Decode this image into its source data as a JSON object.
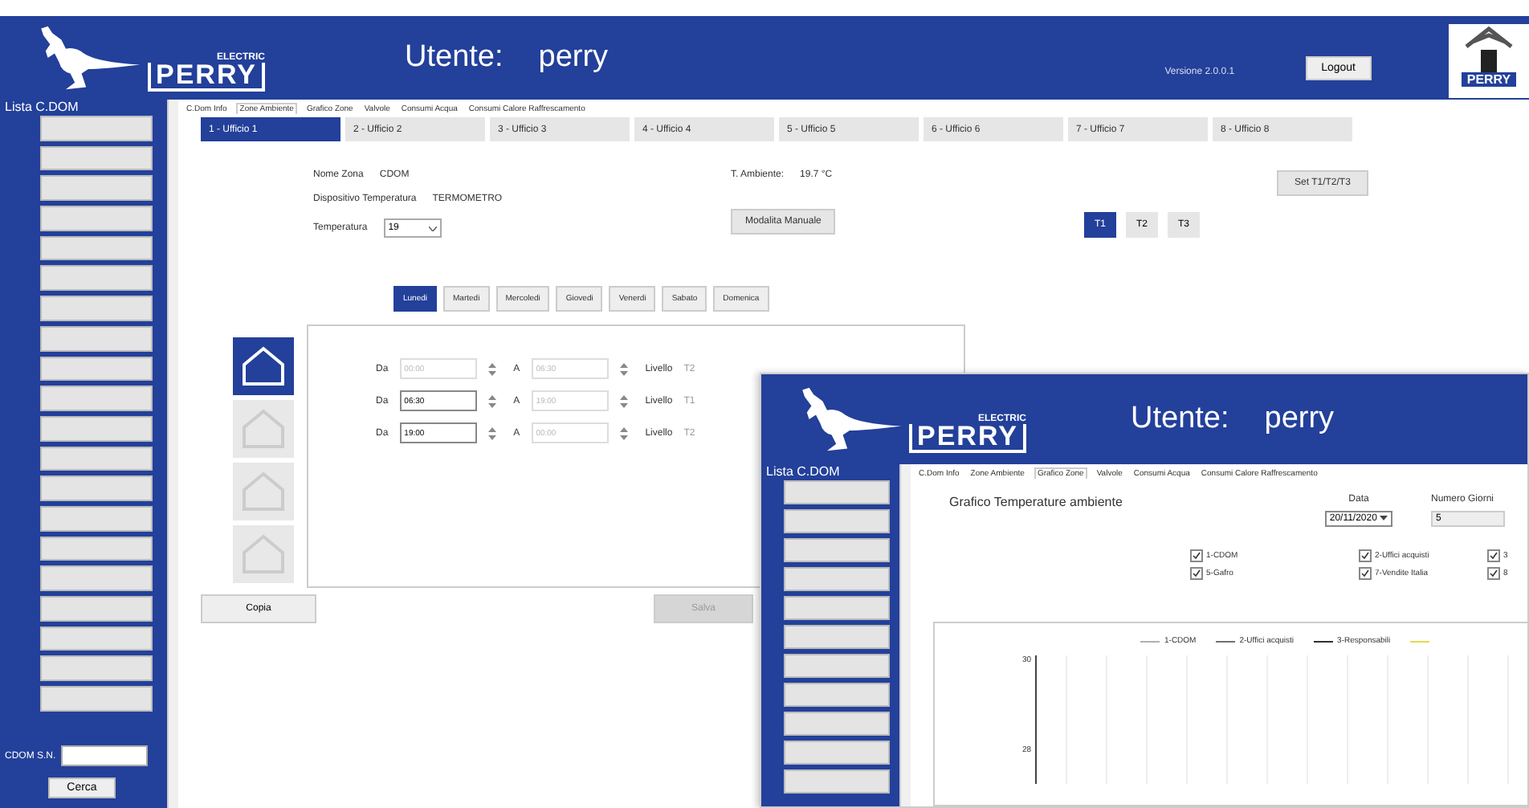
{
  "header": {
    "logo_small": "ELECTRIC",
    "logo_brand": "PERRY",
    "user_label": "Utente:",
    "user_name": "perry",
    "version": "Versione 2.0.0.1",
    "logout_button": "Logout",
    "home_logo_text": "PERRY"
  },
  "sidebar": {
    "title": "Lista C.DOM",
    "search_label": "CDOM S.N.",
    "search_button": "Cerca"
  },
  "sub_tabs": [
    {
      "label": "C.Dom Info",
      "selected": false
    },
    {
      "label": "Zone Ambiente",
      "selected": true
    },
    {
      "label": "Grafico Zone",
      "selected": false
    },
    {
      "label": "Valvole",
      "selected": false
    },
    {
      "label": "Consumi Acqua",
      "selected": false
    },
    {
      "label": "Consumi Calore Raffrescamento",
      "selected": false
    }
  ],
  "zone_tabs": [
    {
      "label": "1 - Ufficio 1",
      "selected": true
    },
    {
      "label": "2 - Ufficio 2",
      "selected": false
    },
    {
      "label": "3 - Ufficio 3",
      "selected": false
    },
    {
      "label": "4 - Ufficio 4",
      "selected": false
    },
    {
      "label": "5 - Ufficio 5",
      "selected": false
    },
    {
      "label": "6 - Ufficio 6",
      "selected": false
    },
    {
      "label": "7 - Ufficio 7",
      "selected": false
    },
    {
      "label": "8 - Ufficio 8",
      "selected": false
    }
  ],
  "zone": {
    "name_label": "Nome Zona",
    "name": "CDOM",
    "device_label": "Dispositivo Temperatura",
    "device": "TERMOMETRO",
    "temp_label": "Temperatura",
    "temp_value": "19",
    "ambient_label": "T. Ambiente:",
    "ambient_value": "19.7 °C",
    "mode_button": "Modalita Manuale",
    "set_button": "Set T1/T2/T3",
    "levels": [
      {
        "label": "T1",
        "selected": true
      },
      {
        "label": "T2",
        "selected": false
      },
      {
        "label": "T3",
        "selected": false
      }
    ]
  },
  "day_tabs": [
    {
      "label": "Lunedi",
      "selected": true
    },
    {
      "label": "Martedi",
      "selected": false
    },
    {
      "label": "Mercoledi",
      "selected": false
    },
    {
      "label": "Giovedi",
      "selected": false
    },
    {
      "label": "Venerdi",
      "selected": false
    },
    {
      "label": "Sabato",
      "selected": false
    },
    {
      "label": "Domenica",
      "selected": false
    }
  ],
  "mode_icons": [
    {
      "selected": true
    },
    {
      "selected": false
    },
    {
      "selected": false
    },
    {
      "selected": false
    }
  ],
  "schedule": [
    {
      "from_label": "Da",
      "from": "00:00",
      "from_disabled": true,
      "to_label": "A",
      "to": "06:30",
      "to_disabled": true,
      "level_label": "Livello",
      "level": "T2"
    },
    {
      "from_label": "Da",
      "from": "06:30",
      "from_disabled": false,
      "to_label": "A",
      "to": "19:00",
      "to_disabled": true,
      "level_label": "Livello",
      "level": "T1"
    },
    {
      "from_label": "Da",
      "from": "19:00",
      "from_disabled": false,
      "to_label": "A",
      "to": "00:00",
      "to_disabled": true,
      "level_label": "Livello",
      "level": "T2"
    }
  ],
  "copy_button": "Copia",
  "save_button": {
    "label": "Salva",
    "disabled": true
  },
  "overlay": {
    "user_label": "Utente:",
    "user_name": "perry",
    "logo_small": "ELECTRIC",
    "logo_brand": "PERRY",
    "sidebar_title": "Lista C.DOM",
    "sub_tabs": [
      {
        "label": "C.Dom Info",
        "selected": false
      },
      {
        "label": "Zone Ambiente",
        "selected": false
      },
      {
        "label": "Grafico Zone",
        "selected": true
      },
      {
        "label": "Valvole",
        "selected": false
      },
      {
        "label": "Consumi Acqua",
        "selected": false
      },
      {
        "label": "Consumi Calore Raffrescamento",
        "selected": false
      }
    ],
    "chart_title": "Grafico Temperature ambiente",
    "date_label": "Data",
    "date_value": "20/11/2020",
    "days_label": "Numero Giorni",
    "days_value": "5",
    "checkboxes": [
      {
        "label": "1-CDOM",
        "checked": true
      },
      {
        "label": "5-Gafro",
        "checked": true
      },
      {
        "label": "2-Uffici acquisti",
        "checked": true
      },
      {
        "label": "7-Vendite Italia",
        "checked": true
      },
      {
        "label": "3",
        "checked": true
      },
      {
        "label": "8",
        "checked": true
      }
    ],
    "legend": [
      {
        "label": "1-CDOM",
        "color": "#b0b0b0"
      },
      {
        "label": "2-Uffici acquisti",
        "color": "#707070"
      },
      {
        "label": "3-Responsabili",
        "color": "#303030"
      },
      {
        "color": "#e8d84a"
      }
    ],
    "yticks": [
      "30",
      "28"
    ]
  }
}
